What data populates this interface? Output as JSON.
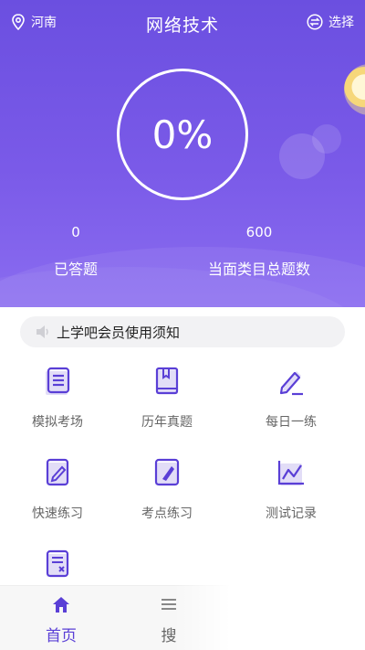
{
  "header": {
    "location": "河南",
    "title": "网络技术",
    "choose_label": "选择",
    "progress_text": "0%",
    "progress_value": 0
  },
  "stats": {
    "answered_value": "0",
    "answered_label": "已答题",
    "total_value": "600",
    "total_label": "当面类目总题数"
  },
  "notice": {
    "text": "上学吧会员使用须知"
  },
  "menu": [
    {
      "label": "模拟考场",
      "icon": "list-doc-icon"
    },
    {
      "label": "历年真题",
      "icon": "book-icon"
    },
    {
      "label": "每日一练",
      "icon": "pencil-icon"
    },
    {
      "label": "快速练习",
      "icon": "edit-doc-icon"
    },
    {
      "label": "考点练习",
      "icon": "tablet-pen-icon"
    },
    {
      "label": "测试记录",
      "icon": "chart-icon"
    },
    {
      "label": "",
      "icon": "doc-x-icon"
    }
  ],
  "tabbar": {
    "home": "首页",
    "second": "搜"
  },
  "colors": {
    "primary": "#6b4fe0",
    "accent": "#5a3fd6"
  }
}
